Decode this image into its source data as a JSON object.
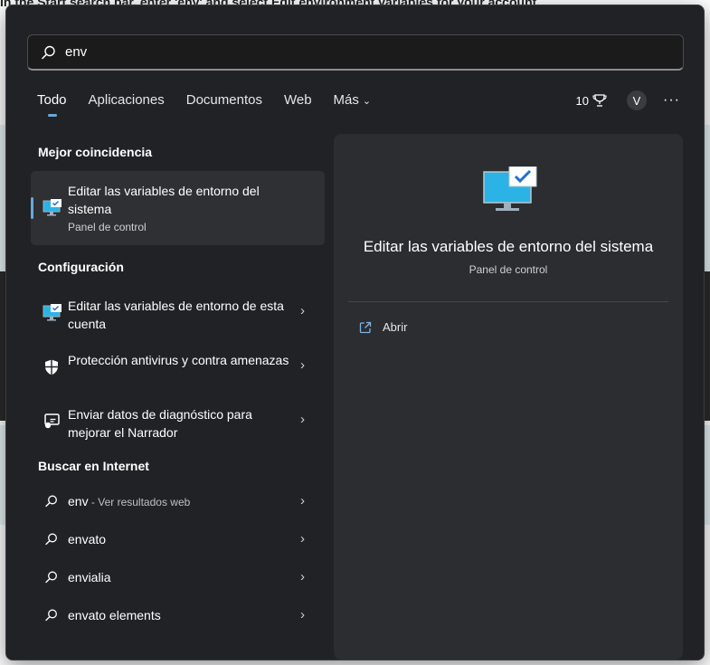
{
  "background": {
    "top_text": "In the Start search bar, enter 'env' and select Edit environment variables for your account."
  },
  "search": {
    "value": "env"
  },
  "tabs": [
    {
      "label": "Todo"
    },
    {
      "label": "Aplicaciones"
    },
    {
      "label": "Documentos"
    },
    {
      "label": "Web"
    },
    {
      "label": "Más"
    }
  ],
  "header": {
    "points": "10",
    "avatar_letter": "V",
    "more": "···"
  },
  "best_match": {
    "heading": "Mejor coincidencia",
    "title": "Editar las variables de entorno del sistema",
    "subtitle": "Panel de control"
  },
  "settings": {
    "heading": "Configuración",
    "items": [
      {
        "label": "Editar las variables de entorno de esta cuenta",
        "icon": "monitor-icon"
      },
      {
        "label": "Protección antivirus y contra amenazas",
        "icon": "shield-icon"
      },
      {
        "label": "Enviar datos de diagnóstico para mejorar el Narrador",
        "icon": "narrator-icon"
      }
    ]
  },
  "web": {
    "heading": "Buscar en Internet",
    "items": [
      {
        "label": "env",
        "hint": " - Ver resultados web"
      },
      {
        "label": "envato",
        "hint": ""
      },
      {
        "label": "envialia",
        "hint": ""
      },
      {
        "label": "envato elements",
        "hint": ""
      }
    ]
  },
  "detail": {
    "title": "Editar las variables de entorno del sistema",
    "subtitle": "Panel de control",
    "action_label": "Abrir"
  },
  "colors": {
    "panel_bg": "#202226",
    "accent": "#6aa7d9",
    "monitor_screen": "#2bb3e6"
  }
}
